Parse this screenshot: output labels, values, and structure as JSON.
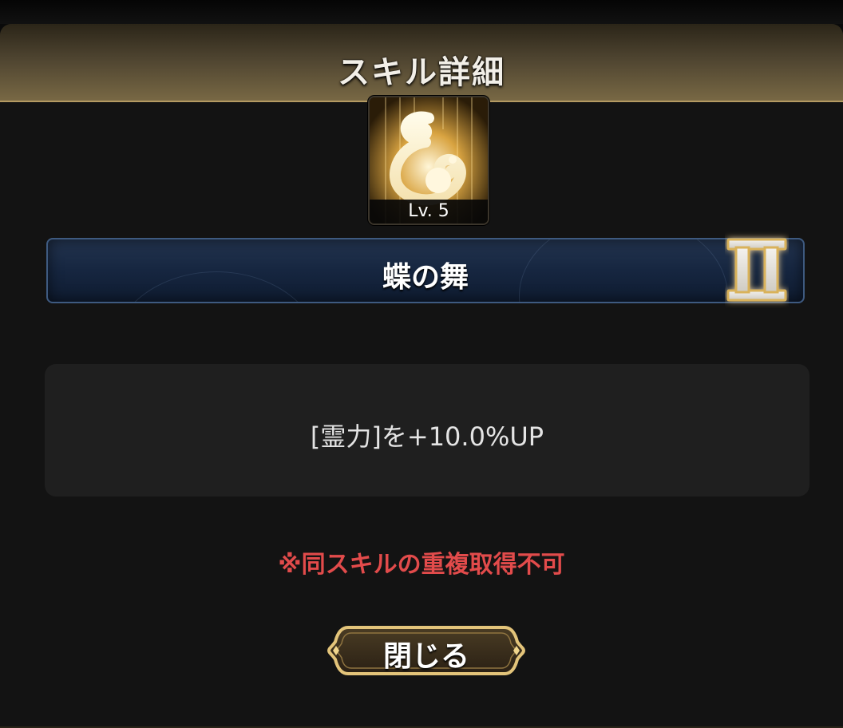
{
  "dialog": {
    "title": "スキル詳細",
    "header_color": "#786844",
    "background_color": "#131313"
  },
  "skill": {
    "icon": "swirl-flame-icon",
    "level": "Lv. 5",
    "name": "蝶の舞",
    "rank": "II",
    "rank_color": "#d9b25a",
    "description": "[霊力]を+10.0%UP",
    "warning": "※同スキルの重複取得不可",
    "warning_color": "#e24b4b"
  },
  "actions": {
    "close_label": "閉じる"
  }
}
